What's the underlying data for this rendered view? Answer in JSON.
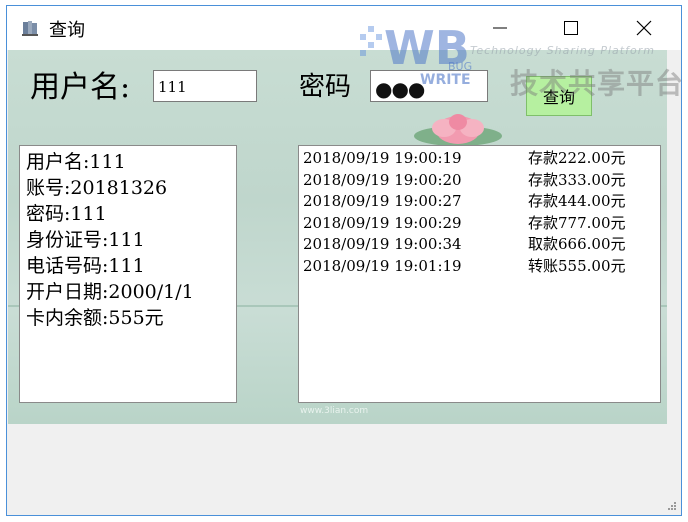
{
  "window": {
    "title": "查询",
    "accent": "#4a90d9"
  },
  "titlebar": {
    "app_icon": "book-stack-icon",
    "minimize_icon": "minimize-icon",
    "maximize_icon": "maximize-icon",
    "close_icon": "close-icon"
  },
  "form": {
    "username_label": "用户名:",
    "username_value": "111",
    "password_label": "密码",
    "password_value": "●●●",
    "query_button": "查询"
  },
  "account_info": [
    "用户名:111",
    "账号:20181326",
    "密码:111",
    "身份证号:111",
    "电话号码:111",
    "开户日期:2000/1/1",
    "卡内余额:555元"
  ],
  "transactions": [
    {
      "time": "2018/09/19 19:00:19",
      "action": "存款222.00元"
    },
    {
      "time": "2018/09/19 19:00:20",
      "action": "存款333.00元"
    },
    {
      "time": "2018/09/19 19:00:27",
      "action": "存款444.00元"
    },
    {
      "time": "2018/09/19 19:00:29",
      "action": "存款777.00元"
    },
    {
      "time": "2018/09/19 19:00:34",
      "action": "取款666.00元"
    },
    {
      "time": "2018/09/19 19:01:19",
      "action": "转账555.00元"
    }
  ],
  "background_watermark": "www.3lian.com",
  "overlay_watermark": {
    "logo_text": "BUG WRITE",
    "english": "Technology Sharing Platform",
    "chinese": "技术共享平台"
  },
  "colors": {
    "button_bg": "#b6f0a0",
    "panel_bg": "#c8ddd3"
  }
}
